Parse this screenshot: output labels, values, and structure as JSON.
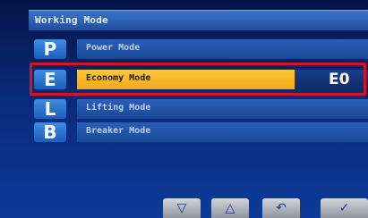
{
  "window": {
    "title": "Working Mode"
  },
  "modes": [
    {
      "letter": "P",
      "label": "Power Mode",
      "code": ""
    },
    {
      "letter": "E",
      "label": "Economy Mode",
      "code": "E0"
    },
    {
      "letter": "L",
      "label": "Lifting Mode",
      "code": ""
    },
    {
      "letter": "B",
      "label": "Breaker Mode",
      "code": ""
    }
  ],
  "selected_mode": "E",
  "softkeys": [
    {
      "icon": "down-arrow-icon",
      "glyph": "▽"
    },
    {
      "icon": "up-arrow-icon",
      "glyph": "△"
    },
    {
      "icon": "return-icon",
      "glyph": "↶"
    },
    {
      "icon": "confirm-check-icon",
      "glyph": "✓"
    }
  ],
  "colors": {
    "selected_row": "#f0a81a",
    "highlight_frame": "#d81420",
    "background": "#0a2a7a"
  }
}
